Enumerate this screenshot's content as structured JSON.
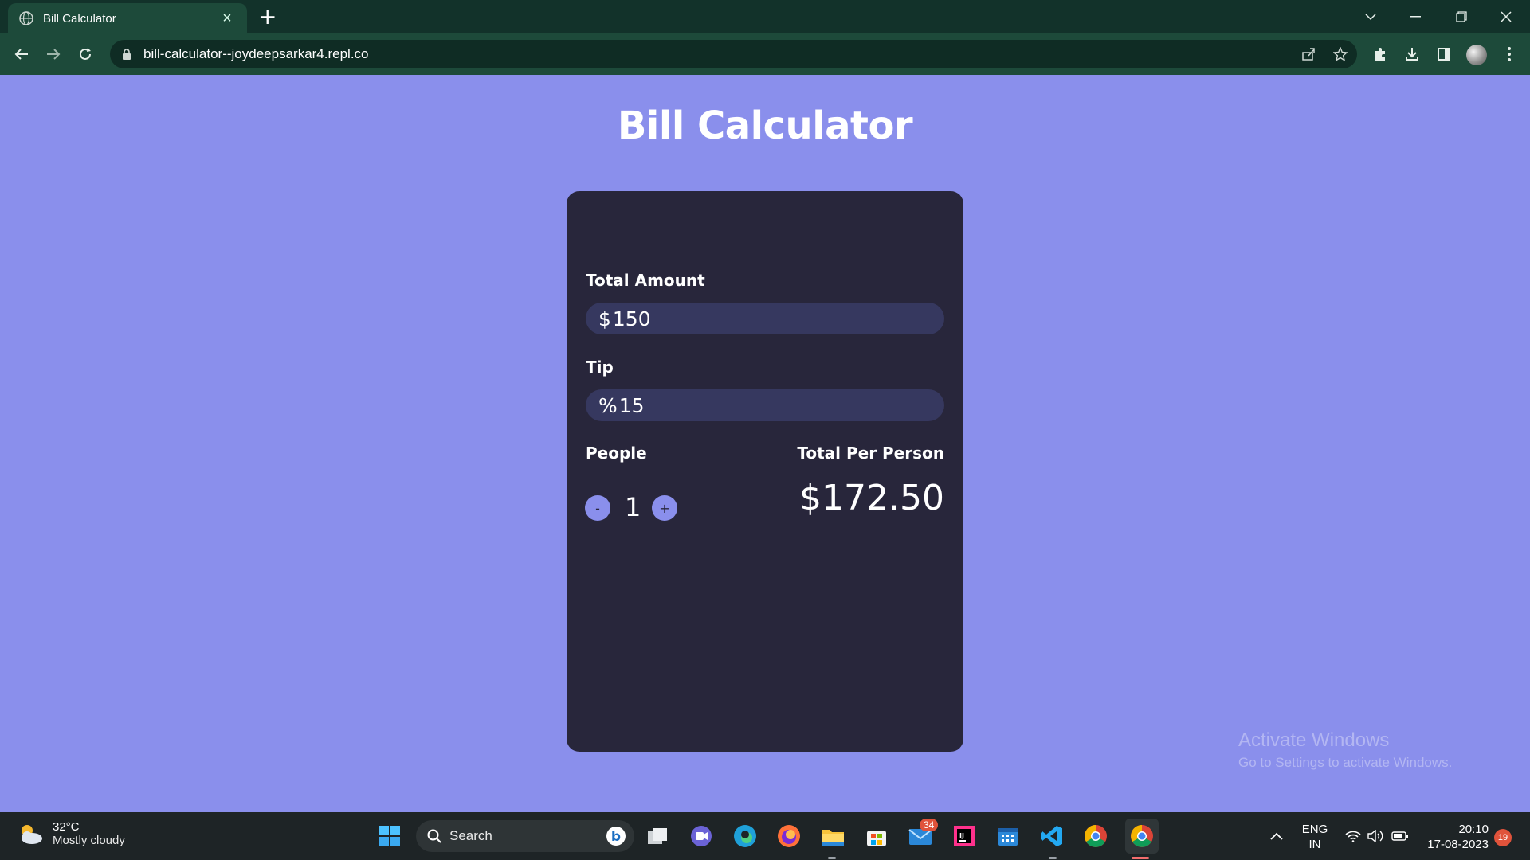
{
  "browser": {
    "tab_title": "Bill Calculator",
    "url": "bill-calculator--joydeepsarkar4.repl.co"
  },
  "page": {
    "title": "Bill Calculator"
  },
  "calculator": {
    "total_amount_label": "Total Amount",
    "total_amount_prefix": "$",
    "total_amount_value": "150",
    "tip_label": "Tip",
    "tip_prefix": "%",
    "tip_value": "15",
    "people_label": "People",
    "decrement_label": "-",
    "increment_label": "+",
    "people_count": "1",
    "total_per_person_label": "Total Per Person",
    "total_per_person_value": "$172.50"
  },
  "watermark": {
    "line1": "Activate Windows",
    "line2": "Go to Settings to activate Windows."
  },
  "taskbar": {
    "weather_temp": "32°C",
    "weather_condition": "Mostly cloudy",
    "search_label": "Search",
    "mail_badge": "34",
    "lang_line1": "ENG",
    "lang_line2": "IN",
    "time": "20:10",
    "date": "17-08-2023",
    "notification_count": "19"
  },
  "colors": {
    "page_bg": "#8a8fec",
    "card_bg": "#28263b",
    "input_bg": "#36385f",
    "chrome_dark": "#12322a",
    "chrome_toolbar": "#1d4a3a"
  }
}
